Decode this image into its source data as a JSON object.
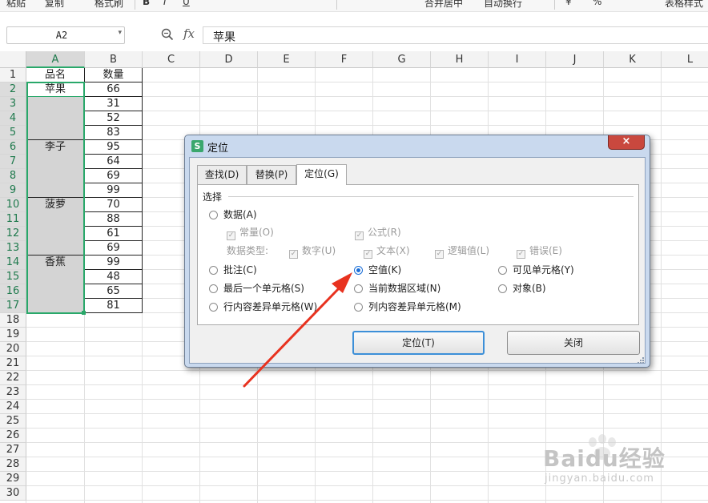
{
  "toolbar": {
    "items": [
      "粘贴",
      "复制",
      "格式刷",
      "B",
      "I",
      "U",
      "合并居中",
      "自动换行",
      "¥",
      "%",
      "表格样式"
    ]
  },
  "formula_bar": {
    "name_box": "A2",
    "fx_label": "fx",
    "content": "苹果"
  },
  "columns": [
    "A",
    "B",
    "C",
    "D",
    "E",
    "F",
    "G",
    "H",
    "I",
    "J",
    "K",
    "L"
  ],
  "selected_column": "A",
  "rows": [
    "1",
    "2",
    "3",
    "4",
    "5",
    "6",
    "7",
    "8",
    "9",
    "10",
    "11",
    "12",
    "13",
    "14",
    "15",
    "16",
    "17",
    "18",
    "19",
    "20",
    "21",
    "22",
    "23",
    "24",
    "25",
    "26",
    "27",
    "28",
    "29",
    "30"
  ],
  "header_row": {
    "a": "品名",
    "b": "数量"
  },
  "data": [
    {
      "a": "苹果",
      "b": "66"
    },
    {
      "a": "",
      "b": "31"
    },
    {
      "a": "",
      "b": "52"
    },
    {
      "a": "",
      "b": "83"
    },
    {
      "a": "李子",
      "b": "95"
    },
    {
      "a": "",
      "b": "64"
    },
    {
      "a": "",
      "b": "69"
    },
    {
      "a": "",
      "b": "99"
    },
    {
      "a": "菠萝",
      "b": "70"
    },
    {
      "a": "",
      "b": "88"
    },
    {
      "a": "",
      "b": "61"
    },
    {
      "a": "",
      "b": "69"
    },
    {
      "a": "香蕉",
      "b": "99"
    },
    {
      "a": "",
      "b": "48"
    },
    {
      "a": "",
      "b": "65"
    },
    {
      "a": "",
      "b": "81"
    }
  ],
  "dialog": {
    "icon": "S",
    "title": "定位",
    "close": "×",
    "tabs": [
      "查找(D)",
      "替换(P)",
      "定位(G)"
    ],
    "active_tab": "定位(G)",
    "group_label": "选择",
    "options": {
      "data": "数据(A)",
      "constants": "常量(O)",
      "formulas": "公式(R)",
      "data_type_label": "数据类型:",
      "numbers": "数字(U)",
      "text": "文本(X)",
      "logicals": "逻辑值(L)",
      "errors": "错误(E)",
      "comments": "批注(C)",
      "blanks": "空值(K)",
      "visible_cells": "可见单元格(Y)",
      "last_cell": "最后一个单元格(S)",
      "current_region": "当前数据区域(N)",
      "objects": "对象(B)",
      "row_diff": "行内容差异单元格(W)",
      "col_diff": "列内容差异单元格(M)"
    },
    "selected_option": "空值(K)",
    "buttons": {
      "goto": "定位(T)",
      "close": "关闭"
    }
  },
  "annotation": {
    "color": "#e8321f"
  },
  "watermark": {
    "text": "Baidu经验",
    "url": "jingyan.baidu.com"
  },
  "colors": {
    "selection": "#29a86a",
    "selected_fill": "#d4d4d4",
    "accent": "#1a6ed8"
  }
}
